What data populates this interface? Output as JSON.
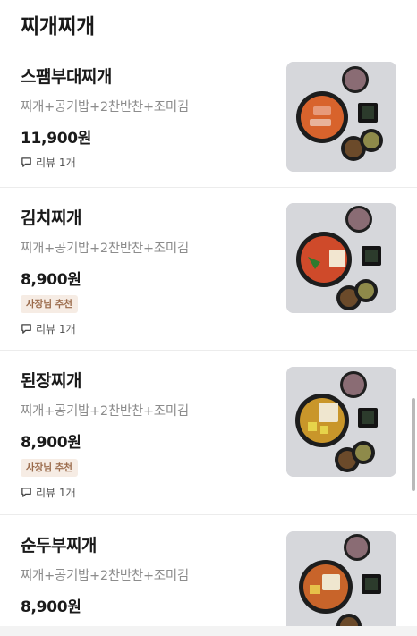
{
  "section": {
    "title": "찌개찌개"
  },
  "items": [
    {
      "name": "스팸부대찌개",
      "desc": "찌개+공기밥+2찬반찬+조미김",
      "price": "11,900원",
      "badge": "",
      "review": "리뷰 1개",
      "stew_color": "#d8632c",
      "topping": "spam"
    },
    {
      "name": "김치찌개",
      "desc": "찌개+공기밥+2찬반찬+조미김",
      "price": "8,900원",
      "badge": "사장님 추천",
      "review": "리뷰 1개",
      "stew_color": "#cf4a2a",
      "topping": "kimchi"
    },
    {
      "name": "된장찌개",
      "desc": "찌개+공기밥+2찬반찬+조미김",
      "price": "8,900원",
      "badge": "사장님 추천",
      "review": "리뷰 1개",
      "stew_color": "#c9962a",
      "topping": "tofu"
    },
    {
      "name": "순두부찌개",
      "desc": "찌개+공기밥+2찬반찬+조미김",
      "price": "8,900원",
      "badge": "",
      "review": "",
      "stew_color": "#c8642a",
      "topping": "soft-tofu"
    }
  ]
}
